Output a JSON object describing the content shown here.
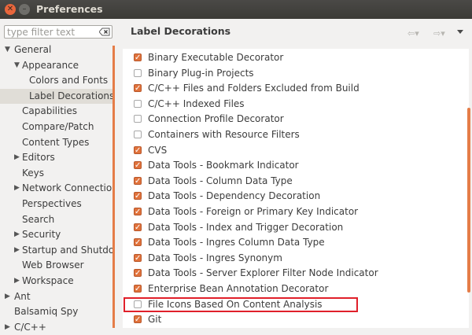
{
  "window": {
    "title": "Preferences"
  },
  "filter": {
    "placeholder": "type filter text"
  },
  "tree": [
    {
      "label": "General",
      "twisty": "▼",
      "indent": 0,
      "selected": false
    },
    {
      "label": "Appearance",
      "twisty": "▼",
      "indent": 1,
      "selected": false
    },
    {
      "label": "Colors and Fonts",
      "twisty": "",
      "indent": 2,
      "selected": false
    },
    {
      "label": "Label Decorations",
      "twisty": "",
      "indent": 2,
      "selected": true
    },
    {
      "label": "Capabilities",
      "twisty": "",
      "indent": 1,
      "selected": false
    },
    {
      "label": "Compare/Patch",
      "twisty": "",
      "indent": 1,
      "selected": false
    },
    {
      "label": "Content Types",
      "twisty": "",
      "indent": 1,
      "selected": false
    },
    {
      "label": "Editors",
      "twisty": "▶",
      "indent": 1,
      "selected": false
    },
    {
      "label": "Keys",
      "twisty": "",
      "indent": 1,
      "selected": false
    },
    {
      "label": "Network Connections",
      "twisty": "▶",
      "indent": 1,
      "selected": false
    },
    {
      "label": "Perspectives",
      "twisty": "",
      "indent": 1,
      "selected": false
    },
    {
      "label": "Search",
      "twisty": "",
      "indent": 1,
      "selected": false
    },
    {
      "label": "Security",
      "twisty": "▶",
      "indent": 1,
      "selected": false
    },
    {
      "label": "Startup and Shutdown",
      "twisty": "▶",
      "indent": 1,
      "selected": false
    },
    {
      "label": "Web Browser",
      "twisty": "",
      "indent": 1,
      "selected": false
    },
    {
      "label": "Workspace",
      "twisty": "▶",
      "indent": 1,
      "selected": false
    },
    {
      "label": "Ant",
      "twisty": "▶",
      "indent": 0,
      "selected": false
    },
    {
      "label": "Balsamiq Spy",
      "twisty": "",
      "indent": 0,
      "selected": false
    },
    {
      "label": "C/C++",
      "twisty": "▶",
      "indent": 0,
      "selected": false
    }
  ],
  "page": {
    "title": "Label Decorations",
    "back_glyph": "⇦▾",
    "forward_glyph": "⇨▾"
  },
  "decorators": [
    {
      "label": "Binary Executable Decorator",
      "checked": true
    },
    {
      "label": "Binary Plug-in Projects",
      "checked": false
    },
    {
      "label": "C/C++ Files and Folders Excluded from Build",
      "checked": true
    },
    {
      "label": "C/C++ Indexed Files",
      "checked": false
    },
    {
      "label": "Connection Profile Decorator",
      "checked": false
    },
    {
      "label": "Containers with Resource Filters",
      "checked": false
    },
    {
      "label": "CVS",
      "checked": true
    },
    {
      "label": "Data Tools - Bookmark Indicator",
      "checked": true
    },
    {
      "label": "Data Tools - Column Data Type",
      "checked": true
    },
    {
      "label": "Data Tools - Dependency Decoration",
      "checked": true
    },
    {
      "label": "Data Tools - Foreign or Primary Key Indicator",
      "checked": true
    },
    {
      "label": "Data Tools - Index and Trigger Decoration",
      "checked": true
    },
    {
      "label": "Data Tools - Ingres Column Data Type",
      "checked": true
    },
    {
      "label": "Data Tools - Ingres Synonym",
      "checked": true
    },
    {
      "label": "Data Tools - Server Explorer Filter Node Indicator",
      "checked": true
    },
    {
      "label": "Enterprise Bean Annotation Decorator",
      "checked": true
    },
    {
      "label": "File Icons Based On Content Analysis",
      "checked": false
    },
    {
      "label": "Git",
      "checked": true
    }
  ],
  "highlighted_item": "File Icons Based On Content Analysis"
}
